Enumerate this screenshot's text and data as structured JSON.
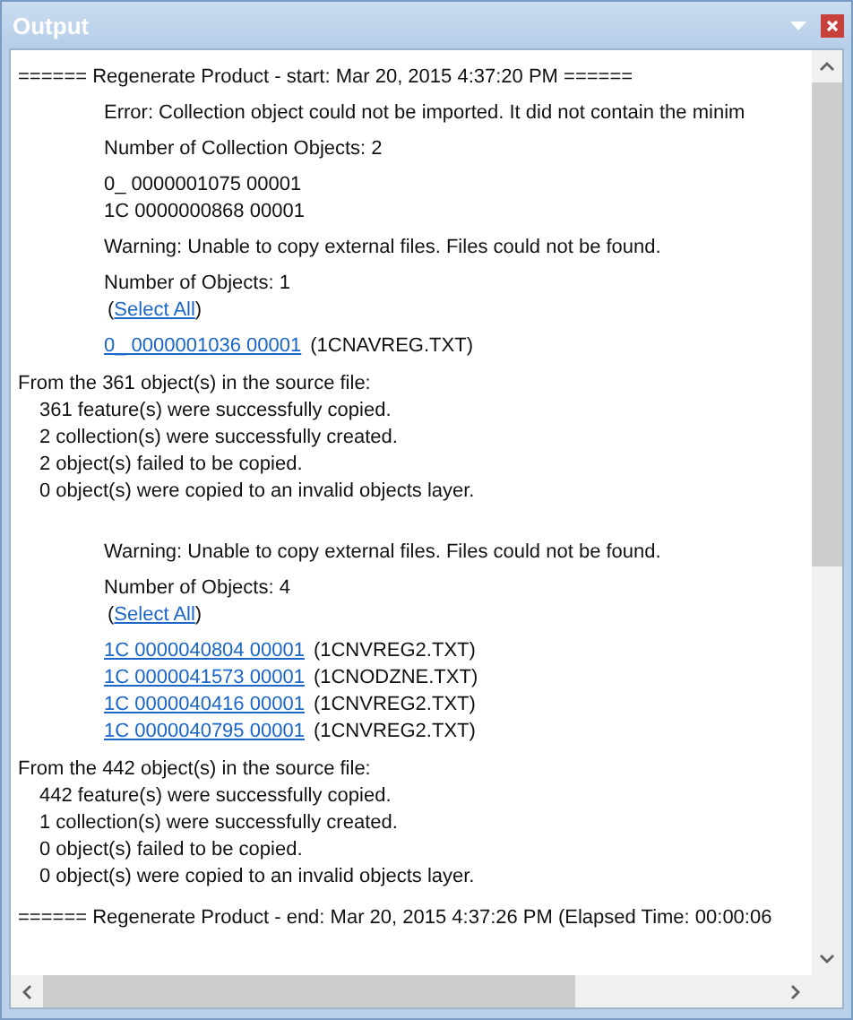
{
  "window": {
    "title": "Output"
  },
  "log": [
    {
      "kind": "header",
      "text": "====== Regenerate Product - start: Mar 20, 2015 4:37:20 PM ======"
    },
    {
      "kind": "message",
      "text": "Error: Collection object could not be imported. It did not contain the minim"
    },
    {
      "kind": "message",
      "text": "Number of Collection Objects: 2"
    },
    {
      "kind": "message",
      "text": "0_ 0000001075 00001"
    },
    {
      "kind": "item",
      "text": "1C 0000000868 00001"
    },
    {
      "kind": "message",
      "text": "Warning: Unable to copy external files. Files could not be found."
    },
    {
      "kind": "message",
      "text": "Number of Objects: 1"
    },
    {
      "kind": "select_all",
      "before": "(",
      "link": "Select All",
      "after": ")"
    },
    {
      "kind": "object_link",
      "link": "0_ 0000001036 00001",
      "file": "(1CNAVREG.TXT)"
    },
    {
      "kind": "summary",
      "title": "From the 361 object(s) in the source file:",
      "children": [
        "361 feature(s) were successfully copied.",
        "2 collection(s) were successfully created.",
        "2 object(s) failed to be copied.",
        "0 object(s) were copied to an invalid objects layer."
      ]
    },
    {
      "kind": "message",
      "text": "Warning: Unable to copy external files. Files could not be found."
    },
    {
      "kind": "message",
      "text": "Number of Objects: 4"
    },
    {
      "kind": "select_all",
      "before": "(",
      "link": "Select All",
      "after": ")"
    },
    {
      "kind": "object_link",
      "link": "1C 0000040804 00001",
      "file": "(1CNVREG2.TXT)"
    },
    {
      "kind": "object_link",
      "link": "1C 0000041573 00001",
      "file": "(1CNODZNE.TXT)"
    },
    {
      "kind": "object_link",
      "link": "1C 0000040416 00001",
      "file": "(1CNVREG2.TXT)"
    },
    {
      "kind": "object_link",
      "link": "1C 0000040795 00001",
      "file": "(1CNVREG2.TXT)"
    },
    {
      "kind": "summary",
      "title": "From the 442 object(s) in the source file:",
      "children": [
        "442 feature(s) were successfully copied.",
        "1 collection(s) were successfully created.",
        "0 object(s) failed to be copied.",
        "0 object(s) were copied to an invalid objects layer."
      ]
    },
    {
      "kind": "header",
      "text": "====== Regenerate Product - end: Mar 20, 2015 4:37:26 PM (Elapsed Time:  00:00:06"
    }
  ]
}
